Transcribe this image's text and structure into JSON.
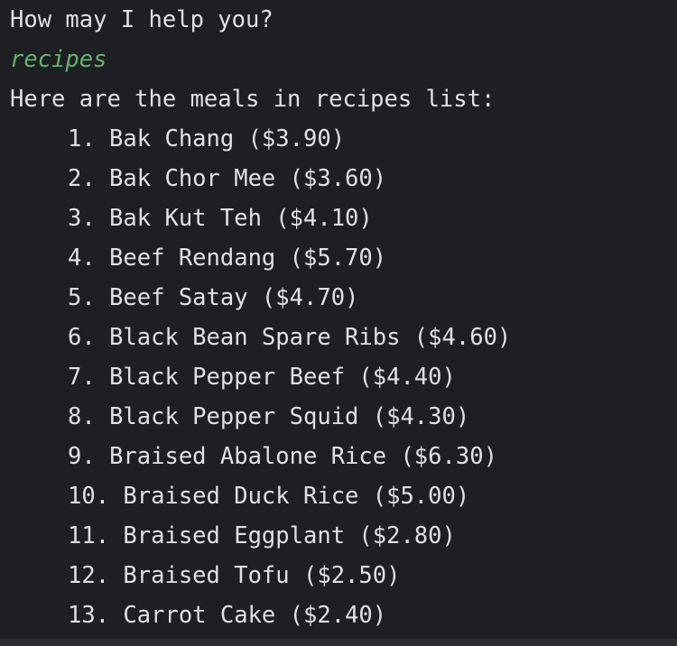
{
  "console": {
    "prompt": "How may I help you?",
    "user_input": "recipes",
    "response_header": "Here are the meals in recipes list:",
    "meals": [
      "1. Bak Chang ($3.90)",
      "2. Bak Chor Mee ($3.60)",
      "3. Bak Kut Teh ($4.10)",
      "4. Beef Rendang ($5.70)",
      "5. Beef Satay ($4.70)",
      "6. Black Bean Spare Ribs ($4.60)",
      "7. Black Pepper Beef ($4.40)",
      "8. Black Pepper Squid ($4.30)",
      "9. Braised Abalone Rice ($6.30)",
      "10. Braised Duck Rice ($5.00)",
      "11. Braised Eggplant ($2.80)",
      "12. Braised Tofu ($2.50)",
      "13. Carrot Cake ($2.40)"
    ]
  },
  "colors": {
    "background": "#1e1f22",
    "text": "#dfe1e5",
    "user_input": "#5fb56a"
  }
}
